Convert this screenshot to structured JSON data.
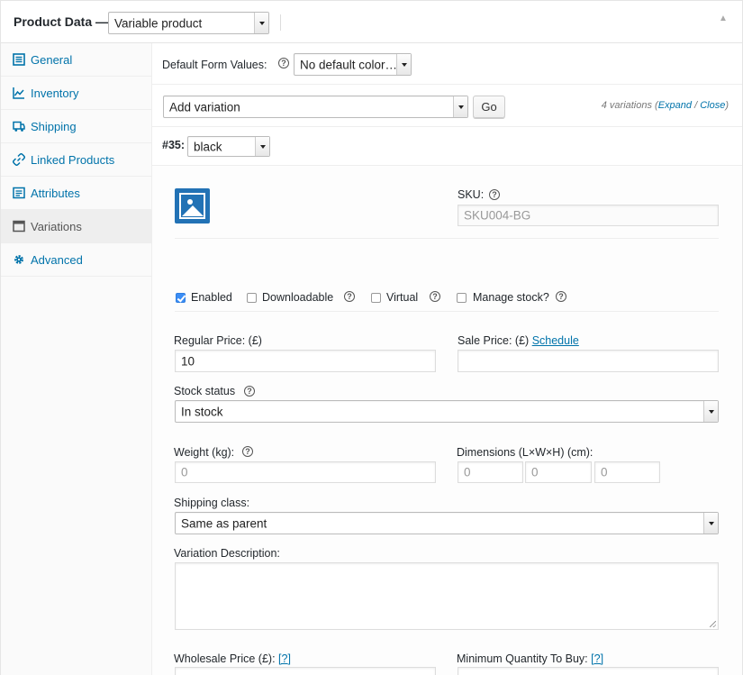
{
  "header": {
    "title": "Product Data —",
    "product_type": "Variable product",
    "collapse_icon": "triangle-up-icon"
  },
  "sidebar": {
    "items": [
      {
        "label": "General",
        "icon": "general-icon"
      },
      {
        "label": "Inventory",
        "icon": "inventory-icon"
      },
      {
        "label": "Shipping",
        "icon": "shipping-icon"
      },
      {
        "label": "Linked Products",
        "icon": "link-icon"
      },
      {
        "label": "Attributes",
        "icon": "attributes-icon"
      },
      {
        "label": "Variations",
        "icon": "variations-icon",
        "active": true
      },
      {
        "label": "Advanced",
        "icon": "gear-icon"
      }
    ]
  },
  "defaults": {
    "label": "Default Form Values:",
    "color_select": "No default color…"
  },
  "variations_bar": {
    "action_select": "Add variation",
    "go_label": "Go",
    "count_text": "4 variations (",
    "expand": "Expand",
    "slash": " / ",
    "close": "Close",
    "end": ")"
  },
  "variation": {
    "number": "#35:",
    "color": "black",
    "sku_label": "SKU:",
    "sku_placeholder": "SKU004-BG",
    "enabled_label": "Enabled",
    "enabled_checked": true,
    "downloadable_label": "Downloadable",
    "downloadable_checked": false,
    "virtual_label": "Virtual",
    "virtual_checked": false,
    "manage_stock_label": "Manage stock?",
    "manage_stock_checked": false,
    "regular_price_label": "Regular Price: (£)",
    "regular_price": "10",
    "sale_price_label": "Sale Price: (£)",
    "schedule_label": "Schedule",
    "sale_price": "",
    "stock_status_label": "Stock status",
    "stock_status": "In stock",
    "weight_label": "Weight (kg):",
    "weight_placeholder": "0",
    "dimensions_label": "Dimensions (L×W×H) (cm):",
    "dim_l": "0",
    "dim_w": "0",
    "dim_h": "0",
    "shipping_class_label": "Shipping class:",
    "shipping_class": "Same as parent",
    "description_label": "Variation Description:",
    "wholesale_label": "Wholesale Price (£):",
    "wholesale_help": "[?]",
    "min_qty_label": "Minimum Quantity To Buy:",
    "min_qty_help": "[?]"
  }
}
